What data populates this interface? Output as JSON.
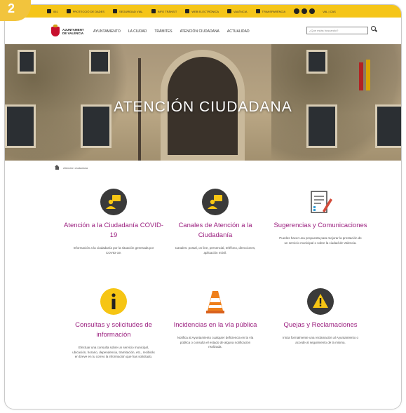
{
  "step_badge": "2",
  "topbar": {
    "items": [
      "061",
      "PROTECCIÓ DE DADES",
      "SEGURIDAD VIAL",
      "INFO TRÀNSIT",
      "WEB ELECTRÒNICA",
      "VALÈNCIA",
      "TRANSPARÈNCIA"
    ],
    "lang": "VAL | CAS"
  },
  "nav": {
    "logo_text": "AJUNTAMENT DE VALÈNCIA",
    "items": [
      "AYUNTAMIENTO",
      "LA CIUDAD",
      "TRÁMITES",
      "ATENCIÓN CIUDADANA",
      "ACTUALIDAD"
    ],
    "search_placeholder": "¿Qué estás buscando?"
  },
  "hero": {
    "title": "ATENCIÓN CIUDADANA"
  },
  "breadcrumb": "Atención ciudadana",
  "cards": [
    {
      "title": "Atención a la Ciudadanía COVID-19",
      "desc": "Información a la ciudadanía por la situación generada por COVID-19.",
      "icon": "person-chat-icon"
    },
    {
      "title": "Canales de Atención a la Ciudadanía",
      "desc": "Canales: postal, on line, presencial, teléfono, direcciones, aplicación móvil.",
      "icon": "person-chat-icon"
    },
    {
      "title": "Sugerencias y Comunicaciones",
      "desc": "Puedes hacer una propuesta para mejorar la prestación de un servicio municipal o sobre la ciudad de Valencia.",
      "icon": "document-pen-icon"
    },
    {
      "title": "Consultas y solicitudes de información",
      "desc": "Efectuar una consulta sobre un servicio municipal, ubicación, horario, dependencia, tramitación, etc., recibirás en breve en tu correo la información que has solicitado.",
      "icon": "info-icon"
    },
    {
      "title": "Incidencias en la vía pública",
      "desc": "Notifica al Ayuntamiento cualquier deficiencia en la vía pública o consulta el estado de alguna notificación realizada.",
      "icon": "traffic-cone-icon"
    },
    {
      "title": "Quejas y Reclamaciones",
      "desc": "Inicia formalmente una reclamación al Ayuntamiento o accede al seguimiento de la misma.",
      "icon": "warning-icon"
    }
  ],
  "colors": {
    "accent": "#9b1f7f",
    "topbar": "#f5c518",
    "icon_dark": "#3a3a3a",
    "icon_yellow": "#f6c514"
  }
}
